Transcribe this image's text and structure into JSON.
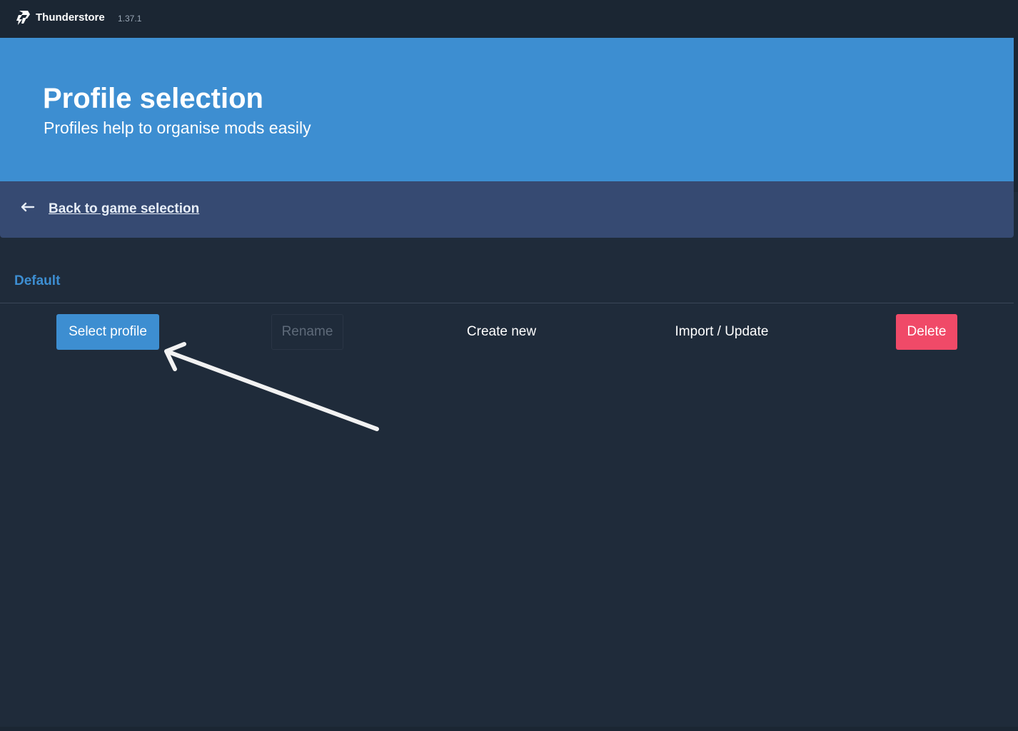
{
  "titlebar": {
    "app_name": "Thunderstore",
    "version": "1.37.1",
    "logo_icon": "thunderstore-logo-icon"
  },
  "hero": {
    "title": "Profile selection",
    "subtitle": "Profiles help to organise mods easily"
  },
  "navigation": {
    "back_icon": "arrow-left-icon",
    "back_label": "Back to game selection"
  },
  "profiles": [
    {
      "name": "Default"
    }
  ],
  "actions": {
    "select_label": "Select profile",
    "rename_label": "Rename",
    "create_label": "Create new",
    "import_label": "Import / Update",
    "delete_label": "Delete"
  },
  "colors": {
    "accent": "#3d8ed1",
    "background": "#1f2b3a",
    "titlebar": "#1b2633",
    "nav_bar": "#364a72",
    "danger": "#f04a68",
    "disabled_text": "#5e6a79"
  },
  "annotation": {
    "icon": "annotation-arrow-icon",
    "target": "select-profile-button"
  }
}
